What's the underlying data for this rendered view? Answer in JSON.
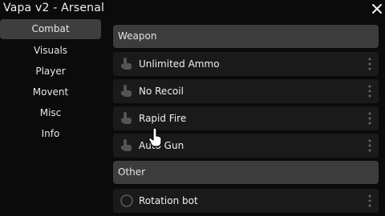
{
  "window": {
    "title": "Vapa v2 - Arsenal",
    "close_icon": "close-icon"
  },
  "sidebar": {
    "items": [
      {
        "label": "Combat",
        "active": true
      },
      {
        "label": "Visuals",
        "active": false
      },
      {
        "label": "Player",
        "active": false
      },
      {
        "label": "Movent",
        "active": false
      },
      {
        "label": "Misc",
        "active": false
      },
      {
        "label": "Info",
        "active": false
      }
    ]
  },
  "main": {
    "sections": [
      {
        "header": "Weapon",
        "items": [
          {
            "label": "Unlimited Ammo",
            "icon": "hand-pointer-icon"
          },
          {
            "label": "No Recoil",
            "icon": "hand-pointer-icon"
          },
          {
            "label": "Rapid Fire",
            "icon": "hand-pointer-icon"
          },
          {
            "label": "Auto Gun",
            "icon": "hand-pointer-icon"
          }
        ]
      },
      {
        "header": "Other",
        "items": [
          {
            "label": "Rotation bot",
            "icon": "toggle-circle-icon"
          }
        ]
      }
    ]
  },
  "colors": {
    "background": "#0b0b0b",
    "active_nav": "#3e3e3e",
    "section_header": "#3c3c3c",
    "row": "#1a1a1a",
    "text": "#f0f0f0",
    "icon_muted": "#5a5a5a"
  }
}
